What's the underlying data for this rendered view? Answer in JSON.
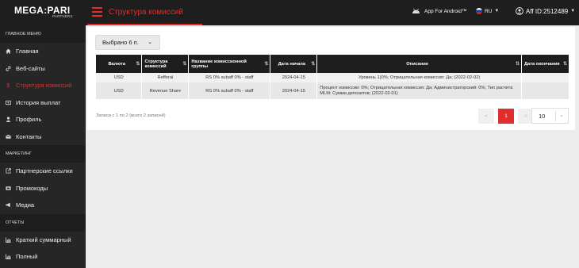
{
  "logo": {
    "brand": "MEGA:PARI",
    "sub": "PARTNERS"
  },
  "header": {
    "title": "Структура комиссий",
    "android_label": "App For Android™",
    "lang": "RU",
    "user_label": "Aff ID:2512489"
  },
  "sidebar": {
    "sections": [
      {
        "title": "ГЛАВНОЕ МЕНЮ"
      },
      {
        "title": "МАРКЕТИНГ"
      },
      {
        "title": "ОТЧЕТЫ"
      }
    ],
    "items": [
      {
        "label": "Главная",
        "icon": "home-icon"
      },
      {
        "label": "Веб-сайты",
        "icon": "link-icon"
      },
      {
        "label": "Структура комиссий",
        "icon": "dollar-icon"
      },
      {
        "label": "История выплат",
        "icon": "wallet-icon"
      },
      {
        "label": "Профиль",
        "icon": "user-icon"
      },
      {
        "label": "Контакты",
        "icon": "mail-icon"
      },
      {
        "label": "Партнерские ссылки",
        "icon": "external-link-icon"
      },
      {
        "label": "Промокоды",
        "icon": "promo-icon"
      },
      {
        "label": "Медиа",
        "icon": "megaphone-icon"
      },
      {
        "label": "Краткий суммарный",
        "icon": "chart-icon"
      },
      {
        "label": "Полный",
        "icon": "chart-icon"
      }
    ]
  },
  "filter": {
    "selected": "Выбрано 6 п."
  },
  "table": {
    "columns": [
      "Валюта",
      "Структура комиссий",
      "Название комиссионной группы",
      "Дата начала",
      "Описание",
      "Дата окончания"
    ],
    "rows": [
      [
        "USD",
        "Refferal",
        "RS 0% subaff 0% - staff",
        "2024-04-15",
        "Уровень 1)0%; Отрицательная комиссия: Да; (2022-02-02)",
        ""
      ],
      [
        "USD",
        "Revenue Share",
        "RS 0% subaff 0% - staff",
        "2024-04-15",
        "Процент комиссии: 0%; Отрицательная комиссия: Да; Администраторский: 0%; Тип расчета MLM: Сумма депозитов; (2022-02-01)",
        ""
      ]
    ]
  },
  "footer": {
    "info": "Записи с 1 по 2 (всего 2 записей)",
    "prev": "<",
    "page": "1",
    "next": ">",
    "per_page": "10"
  },
  "colors": {
    "accent": "#e02d2d",
    "dark": "#1e1e1e",
    "sidebar": "#262626"
  }
}
